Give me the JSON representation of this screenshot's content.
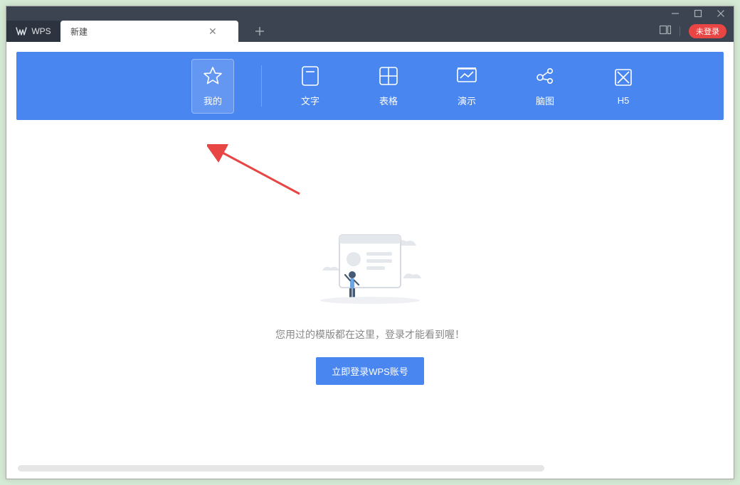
{
  "window": {
    "home_tab": "WPS",
    "doc_tab": "新建",
    "login_pill": "未登录"
  },
  "nav": {
    "items": [
      {
        "label": "我的"
      },
      {
        "label": "文字"
      },
      {
        "label": "表格"
      },
      {
        "label": "演示"
      },
      {
        "label": "脑图"
      },
      {
        "label": "H5"
      }
    ]
  },
  "empty": {
    "message": "您用过的模版都在这里，登录才能看到喔！",
    "button": "立即登录WPS账号"
  }
}
